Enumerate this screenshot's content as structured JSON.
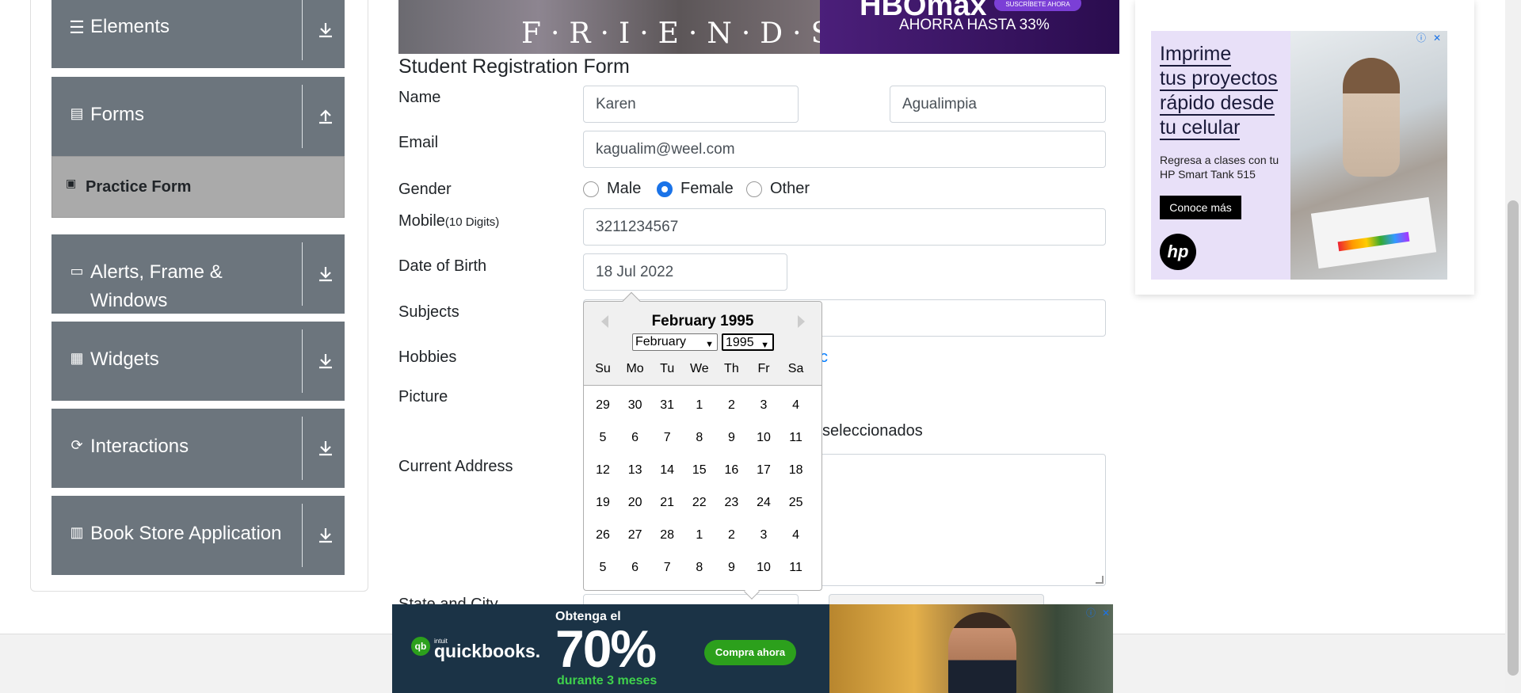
{
  "sidebar": {
    "groups": [
      {
        "label": "Elements",
        "icon": "menu-icon",
        "arrow": "download"
      },
      {
        "label": "Forms",
        "icon": "document-icon",
        "arrow": "upload"
      },
      {
        "label": "Alerts, Frame &",
        "label2": "Windows",
        "icon": "window-icon",
        "arrow": "download"
      },
      {
        "label": "Widgets",
        "icon": "widgets-icon",
        "arrow": "download"
      },
      {
        "label": "Interactions",
        "icon": "refresh-icon",
        "arrow": "download"
      },
      {
        "label": "Book Store Application",
        "icon": "books-icon",
        "arrow": "download"
      }
    ],
    "active_item": "Practice Form"
  },
  "ads": {
    "top": {
      "friends_logo": "F·R·I·E·N·D·S",
      "hbo_logo": "HBOmax",
      "hbo_button": "SUSCRÍBETE AHORA",
      "hbo_offer": "AHORRA HASTA 33%"
    },
    "right": {
      "headline": [
        "Imprime",
        "tus proyectos",
        "rápido desde",
        "tu celular"
      ],
      "sub": "Regresa a clases con tu HP Smart Tank 515",
      "cta": "Conoce más",
      "logo": "hp"
    },
    "bottom": {
      "intuit": "intuit",
      "brand": "quickbooks.",
      "lead": "Obtenga el",
      "percent": "70%",
      "duration": "durante 3 meses",
      "cta": "Compra ahora"
    }
  },
  "form": {
    "title": "Student Registration Form",
    "labels": {
      "name": "Name",
      "email": "Email",
      "gender": "Gender",
      "mobile": "Mobile",
      "mobile_hint": "(10 Digits)",
      "dob": "Date of Birth",
      "subjects": "Subjects",
      "hobbies": "Hobbies",
      "picture": "Picture",
      "address": "Current Address",
      "state_city": "State and City"
    },
    "first_name": "Karen",
    "last_name": "Agualimpia",
    "email": "kagualim@weel.com",
    "gender_options": [
      "Male",
      "Female",
      "Other"
    ],
    "gender_selected": "Female",
    "mobile": "3211234567",
    "dob": "18 Jul 2022",
    "hobby_tail": "c",
    "upload_tail": "seleccionados"
  },
  "datepicker": {
    "title": "February 1995",
    "month_select": "February",
    "year_select": "1995",
    "day_names": [
      "Su",
      "Mo",
      "Tu",
      "We",
      "Th",
      "Fr",
      "Sa"
    ],
    "weeks": [
      [
        "29",
        "30",
        "31",
        "1",
        "2",
        "3",
        "4"
      ],
      [
        "5",
        "6",
        "7",
        "8",
        "9",
        "10",
        "11"
      ],
      [
        "12",
        "13",
        "14",
        "15",
        "16",
        "17",
        "18"
      ],
      [
        "19",
        "20",
        "21",
        "22",
        "23",
        "24",
        "25"
      ],
      [
        "26",
        "27",
        "28",
        "1",
        "2",
        "3",
        "4"
      ],
      [
        "5",
        "6",
        "7",
        "8",
        "9",
        "10",
        "11"
      ]
    ]
  },
  "colors": {
    "sidebar_group": "#6c757d",
    "active_item": "#aaaaaa",
    "accent": "#1a73e8"
  }
}
